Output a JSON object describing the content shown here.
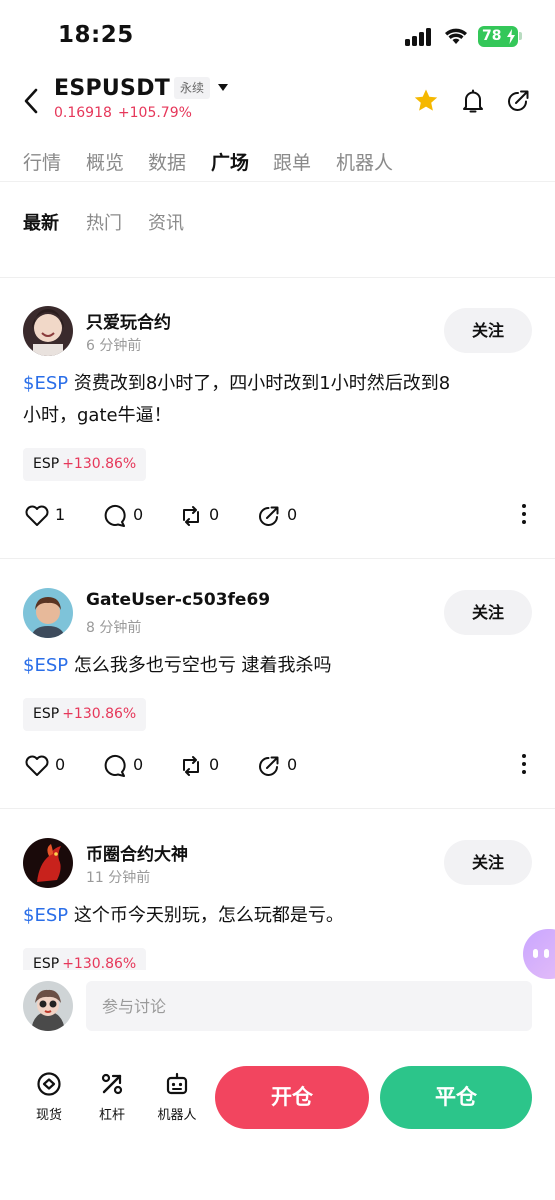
{
  "status": {
    "time": "18:25",
    "battery": "78"
  },
  "header": {
    "symbol": "ESPUSDT",
    "contract_type": "永续",
    "price": "0.16918",
    "change": "+105.79%"
  },
  "tabs": [
    {
      "label": "行情"
    },
    {
      "label": "概览"
    },
    {
      "label": "数据"
    },
    {
      "label": "广场",
      "active": true
    },
    {
      "label": "跟单"
    },
    {
      "label": "机器人"
    }
  ],
  "subtabs": [
    {
      "label": "最新",
      "active": true
    },
    {
      "label": "热门"
    },
    {
      "label": "资讯"
    }
  ],
  "follow_label": "关注",
  "posts": [
    {
      "username": "只爱玩合约",
      "time": "6 分钟前",
      "tag": "$ESP",
      "text_line1": " 资费改到8小时了，四小时改到1小时然后改到8",
      "text_line2": "小时，gate牛逼！",
      "chip_symbol": "ESP",
      "chip_change": "+130.86%",
      "likes": "1",
      "comments": "0",
      "reposts": "0",
      "shares": "0"
    },
    {
      "username": "GateUser-c503fe69",
      "time": "8 分钟前",
      "tag": "$ESP",
      "text_line1": " 怎么我多也亏空也亏  逮着我杀吗",
      "chip_symbol": "ESP",
      "chip_change": "+130.86%",
      "likes": "0",
      "comments": "0",
      "reposts": "0",
      "shares": "0"
    },
    {
      "username": "币圈合约大神",
      "time": "11 分钟前",
      "tag": "$ESP",
      "text_line1": " 这个币今天别玩，怎么玩都是亏。",
      "chip_symbol": "ESP",
      "chip_change": "+130.86%"
    }
  ],
  "discussion": {
    "placeholder": "参与讨论"
  },
  "bottom_nav": [
    {
      "label": "现货",
      "icon": "spot-icon"
    },
    {
      "label": "杠杆",
      "icon": "leverage-icon"
    },
    {
      "label": "机器人",
      "icon": "robot-icon"
    }
  ],
  "open_label": "开仓",
  "close_label": "平仓",
  "colors": {
    "up": "#e6375a",
    "buy": "#f2455f",
    "sell": "#2cc58a",
    "tag": "#2a6ee8",
    "star": "#f5b800"
  }
}
